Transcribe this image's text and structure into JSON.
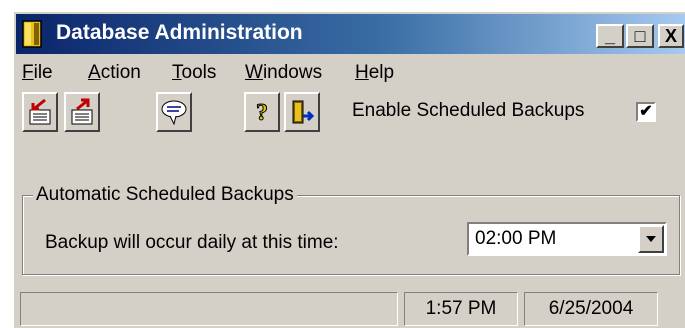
{
  "window": {
    "title": "Database Administration",
    "minimize_label": "_",
    "maximize_label": "□",
    "close_label": "X"
  },
  "menubar": {
    "items": [
      {
        "accel": "F",
        "rest": "ile"
      },
      {
        "accel": "A",
        "rest": "ction"
      },
      {
        "accel": "T",
        "rest": "ools"
      },
      {
        "accel": "W",
        "rest": "indows"
      },
      {
        "accel": "H",
        "rest": "elp"
      }
    ]
  },
  "toolbar": {
    "buttons": [
      "import-icon",
      "export-icon",
      "chat-icon",
      "help-icon",
      "exit-icon"
    ],
    "enable_label": "Enable Scheduled Backups",
    "enable_checked_mark": "✔"
  },
  "group": {
    "title": "Automatic Scheduled Backups",
    "label": "Backup will occur daily at this time:",
    "time_value": "02:00 PM"
  },
  "status": {
    "message": "",
    "time": "1:57 PM",
    "date": "6/25/2004"
  },
  "colors": {
    "title_gradient_start": "#0a246a",
    "title_gradient_end": "#a6caf0",
    "face": "#d4d0c8"
  }
}
